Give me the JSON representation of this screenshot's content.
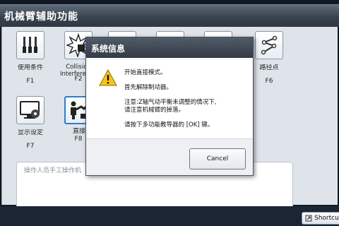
{
  "window": {
    "title": "机械臂辅助功能"
  },
  "functions": [
    {
      "label": "使用条件",
      "key": "F1",
      "icon": "usage-conditions-icon"
    },
    {
      "label": "Collision Interference",
      "key": "F2",
      "icon": "collision-icon"
    },
    {
      "label": "路径点",
      "key": "F6",
      "icon": "path-point-icon"
    },
    {
      "label": "显示设定",
      "key": "F7",
      "icon": "display-settings-icon"
    },
    {
      "label": "直接教导",
      "key": "F8",
      "icon": "direct-teach-icon"
    }
  ],
  "status": {
    "text": "操作人员手工操作机"
  },
  "shortcut": {
    "label": "Shortcu"
  },
  "dialog": {
    "title": "系统信息",
    "lines": [
      "开始直接模式。",
      "首先解除制动器。",
      "注意:Z轴气动平衡未调整的情况下,",
      "请注意机械臂的掉落。",
      "请按下多功能教导器的 [OK] 键。"
    ],
    "cancel_label": "Cancel",
    "icon": "warning-icon",
    "accent": "#f5c518"
  }
}
